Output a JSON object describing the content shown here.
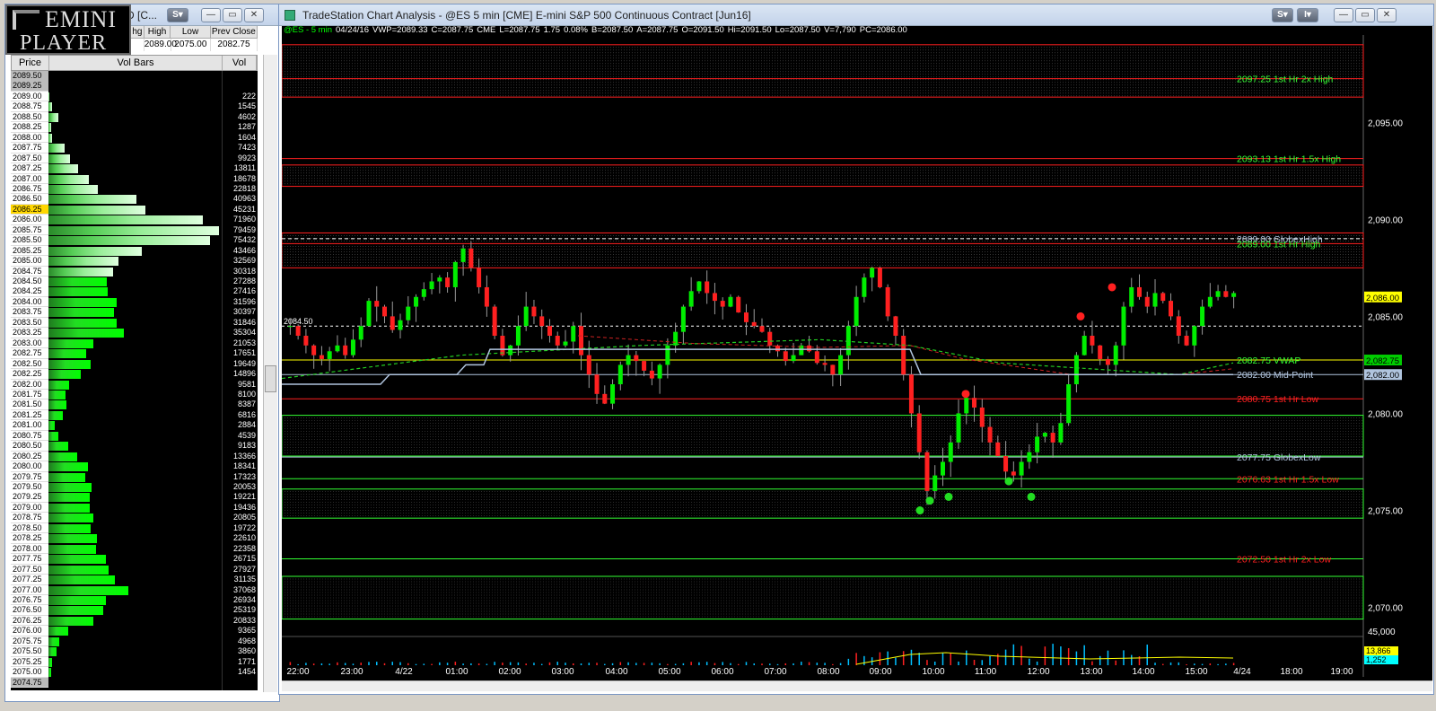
{
  "logo": {
    "line1": "EMINI",
    "line2": "PLAYER"
  },
  "left_window": {
    "title": "D [C...",
    "quote_headers": [
      "hg",
      "High",
      "Low",
      "Prev Close"
    ],
    "quote_values": [
      "",
      "2089.00",
      "2075.00",
      "2082.75"
    ],
    "ladder_headers": [
      "Price",
      "Vol Bars",
      "Vol"
    ]
  },
  "ladder": [
    {
      "p": "2089.50",
      "v": "",
      "c": "gr"
    },
    {
      "p": "2089.25",
      "v": "",
      "c": "gr"
    },
    {
      "p": "2089.00",
      "v": "222"
    },
    {
      "p": "2088.75",
      "v": "1545"
    },
    {
      "p": "2088.50",
      "v": "4602"
    },
    {
      "p": "2088.25",
      "v": "1287"
    },
    {
      "p": "2088.00",
      "v": "1604"
    },
    {
      "p": "2087.75",
      "v": "7423"
    },
    {
      "p": "2087.50",
      "v": "9923"
    },
    {
      "p": "2087.25",
      "v": "13811"
    },
    {
      "p": "2087.00",
      "v": "18678"
    },
    {
      "p": "2086.75",
      "v": "22818"
    },
    {
      "p": "2086.50",
      "v": "40963"
    },
    {
      "p": "2086.25",
      "v": "45231",
      "c": "hl"
    },
    {
      "p": "2086.00",
      "v": "71960"
    },
    {
      "p": "2085.75",
      "v": "79459"
    },
    {
      "p": "2085.50",
      "v": "75432"
    },
    {
      "p": "2085.25",
      "v": "43466"
    },
    {
      "p": "2085.00",
      "v": "32569"
    },
    {
      "p": "2084.75",
      "v": "30318"
    },
    {
      "p": "2084.50",
      "v": "27288"
    },
    {
      "p": "2084.25",
      "v": "27416"
    },
    {
      "p": "2084.00",
      "v": "31596"
    },
    {
      "p": "2083.75",
      "v": "30397"
    },
    {
      "p": "2083.50",
      "v": "31846"
    },
    {
      "p": "2083.25",
      "v": "35304"
    },
    {
      "p": "2083.00",
      "v": "21053"
    },
    {
      "p": "2082.75",
      "v": "17651"
    },
    {
      "p": "2082.50",
      "v": "19649"
    },
    {
      "p": "2082.25",
      "v": "14896"
    },
    {
      "p": "2082.00",
      "v": "9581"
    },
    {
      "p": "2081.75",
      "v": "8100"
    },
    {
      "p": "2081.50",
      "v": "8387"
    },
    {
      "p": "2081.25",
      "v": "6816"
    },
    {
      "p": "2081.00",
      "v": "2884"
    },
    {
      "p": "2080.75",
      "v": "4539"
    },
    {
      "p": "2080.50",
      "v": "9183"
    },
    {
      "p": "2080.25",
      "v": "13366"
    },
    {
      "p": "2080.00",
      "v": "18341"
    },
    {
      "p": "2079.75",
      "v": "17323"
    },
    {
      "p": "2079.50",
      "v": "20053"
    },
    {
      "p": "2079.25",
      "v": "19221"
    },
    {
      "p": "2079.00",
      "v": "19436"
    },
    {
      "p": "2078.75",
      "v": "20805"
    },
    {
      "p": "2078.50",
      "v": "19722"
    },
    {
      "p": "2078.25",
      "v": "22610"
    },
    {
      "p": "2078.00",
      "v": "22358"
    },
    {
      "p": "2077.75",
      "v": "26715"
    },
    {
      "p": "2077.50",
      "v": "27927"
    },
    {
      "p": "2077.25",
      "v": "31135"
    },
    {
      "p": "2077.00",
      "v": "37068"
    },
    {
      "p": "2076.75",
      "v": "26934"
    },
    {
      "p": "2076.50",
      "v": "25319"
    },
    {
      "p": "2076.25",
      "v": "20833"
    },
    {
      "p": "2076.00",
      "v": "9365"
    },
    {
      "p": "2075.75",
      "v": "4968"
    },
    {
      "p": "2075.50",
      "v": "3860"
    },
    {
      "p": "2075.25",
      "v": "1771"
    },
    {
      "p": "2075.00",
      "v": "1454"
    },
    {
      "p": "2074.75",
      "v": "",
      "c": "gr"
    }
  ],
  "right_window": {
    "title": "TradeStation Chart Analysis - @ES 5 min [CME] E-mini S&P 500 Continuous Contract [Jun16]"
  },
  "chart_header": [
    "@ES - 5 min",
    "04/24/16",
    "VWP=2089.33",
    "C=2087.75",
    "CME",
    "L=2087.75",
    "1.75",
    "0.08%",
    "B=2087.50",
    "A=2087.75",
    "O=2091.50",
    "Hi=2091.50",
    "Lo=2087.50",
    "V=7,790",
    "PC=2086.00"
  ],
  "chart_data": {
    "type": "candlestick",
    "y_axis": {
      "min": 2068.5,
      "max": 2099.5,
      "ticks": [
        "2,095.00",
        "2,090.00",
        "2,085.00",
        "2,080.00",
        "2,075.00",
        "2,070.00"
      ],
      "tick_values": [
        2095,
        2090,
        2085,
        2080,
        2075,
        2070
      ]
    },
    "x_labels": [
      "22:00",
      "23:00",
      "4/22",
      "01:00",
      "02:00",
      "03:00",
      "04:00",
      "05:00",
      "06:00",
      "07:00",
      "08:00",
      "09:00",
      "10:00",
      "11:00",
      "12:00",
      "13:00",
      "14:00",
      "15:00",
      "4/24",
      "18:00",
      "19:00"
    ],
    "price_tags": [
      {
        "text": "2,086.00",
        "bg": "#ffff00",
        "fg": "#000",
        "v": 2086.0
      },
      {
        "text": "2,082.75",
        "bg": "#00cc00",
        "fg": "#000",
        "v": 2082.75
      },
      {
        "text": "2,082.00",
        "bg": "#b0c4de",
        "fg": "#000",
        "v": 2082.0
      }
    ],
    "left_label": "2084.50",
    "levels": [
      {
        "v": 2097.25,
        "text": "2097.25 1st Hr 2x High",
        "color": "#33ff33",
        "line": "#ff2020"
      },
      {
        "v": 2093.13,
        "text": "2093.13 1st Hr 1.5x High",
        "color": "#33ff33",
        "line": "#ff2020"
      },
      {
        "v": 2089.0,
        "text": "2089.00 GlobexHigh",
        "color": "#b0c4de",
        "line": "#ffffff"
      },
      {
        "v": 2088.75,
        "text": "2089.00 1st Hr High",
        "color": "#33ff33",
        "line": "#ff2020"
      },
      {
        "v": 2082.75,
        "text": "2082.75 VWAP",
        "color": "#33ff33",
        "line": "#ffff00"
      },
      {
        "v": 2082.0,
        "text": "2082.00 Mid-Point",
        "color": "#b0c4de",
        "line": "#b0c4de"
      },
      {
        "v": 2080.75,
        "text": "2080.75 1st Hr Low",
        "color": "#ff2020",
        "line": "#ff2020"
      },
      {
        "v": 2077.75,
        "text": "2077.75 GlobexLow",
        "color": "#b0c4de",
        "line": "#b0c4de"
      },
      {
        "v": 2076.63,
        "text": "2076.63 1st Hr 1.5x Low",
        "color": "#ff2020",
        "line": "#33ff33"
      },
      {
        "v": 2072.5,
        "text": "2072.50 1st Hr 2x Low",
        "color": "#ff2020",
        "line": "#33ff33"
      }
    ],
    "zones": [
      [
        2099.0,
        2096.3,
        "#ff2020"
      ],
      [
        2092.8,
        2091.7,
        "#ff2020"
      ],
      [
        2089.3,
        2087.5,
        "#ff2020"
      ],
      [
        2079.9,
        2077.8,
        "#33ff33"
      ],
      [
        2076.1,
        2074.6,
        "#33ff33"
      ],
      [
        2071.6,
        2069.4,
        "#33ff33"
      ]
    ],
    "volume": {
      "ticks": [
        "45,000"
      ],
      "tags": [
        {
          "text": "13,866",
          "bg": "#ffff00"
        },
        {
          "text": "1,252",
          "bg": "#00ffff"
        }
      ]
    }
  }
}
